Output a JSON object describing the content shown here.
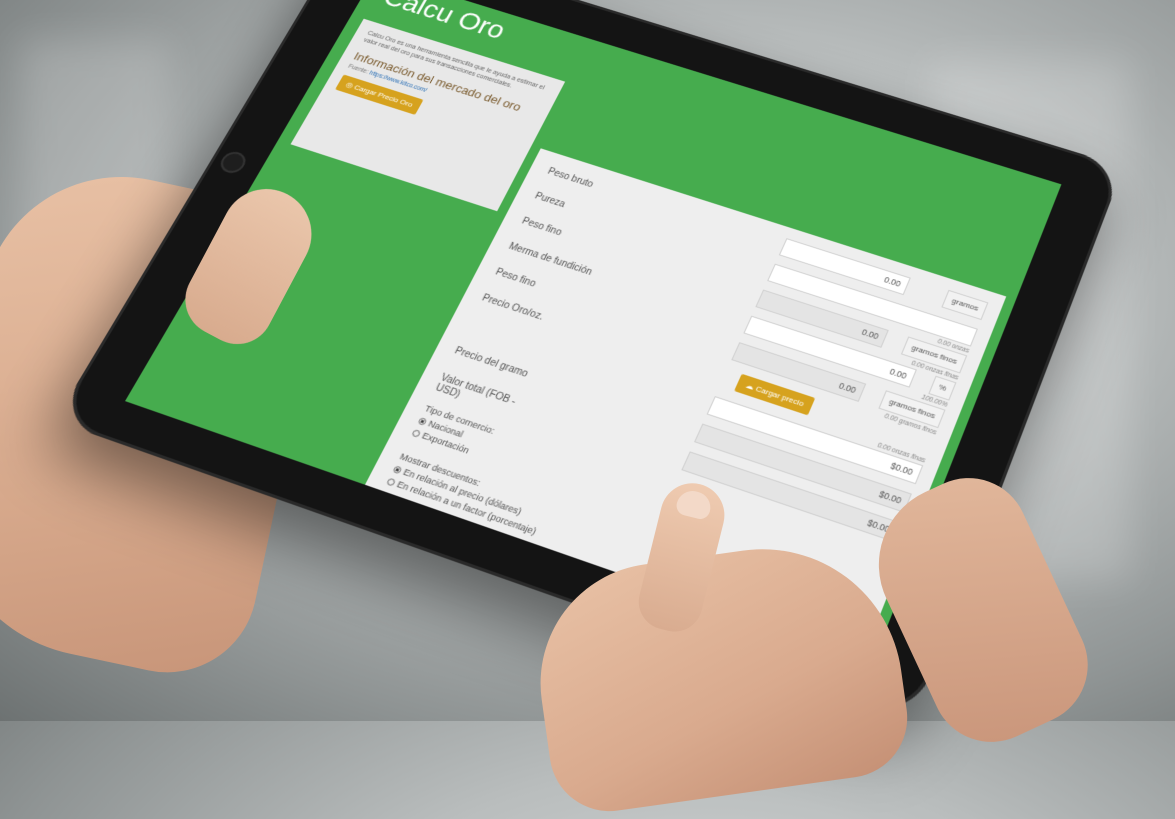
{
  "app": {
    "title": "Calcu Oro",
    "description": "Calcu Oro es una herramienta sencilla que le ayuda a estimar el valor real del oro para sus transacciones comerciales.",
    "market_heading": "Información del mercado del oro",
    "source_label": "Fuente:",
    "source_link": "https://www.kitco.com/",
    "load_gold_price_button": "Cargar Precio Oro"
  },
  "form": {
    "fields": [
      {
        "label": "Peso bruto",
        "value": "0.00",
        "unit": "gramos",
        "hint": "0.00 onzas"
      },
      {
        "label": "Pureza",
        "value": "",
        "unit": "",
        "hint": "100.00%"
      },
      {
        "label": "Peso fino",
        "value": "0.00",
        "unit": "gramos finos",
        "hint": "0.00 onzas finas"
      },
      {
        "label": "Merma de fundición",
        "value": "0.00",
        "unit": "%",
        "hint": "0.00 gramos finos"
      },
      {
        "label": "Peso fino",
        "value": "0.00",
        "unit": "gramos finos",
        "hint": "0.00 onzas finas"
      },
      {
        "label": "Precio Oro/oz.",
        "value": "$0.00",
        "unit": "",
        "hint": ""
      },
      {
        "label": "Precio del gramo",
        "value": "$0.00",
        "unit": "",
        "hint": ""
      },
      {
        "label": "Valor total (FOB - USD)",
        "value": "$0.00",
        "unit": "",
        "hint": ""
      }
    ],
    "hint_fine_oz_extra": "0.00 onzas finas",
    "load_price_button": "Cargar precio",
    "trade_type": {
      "label": "Tipo de comercio:",
      "options": [
        "Nacional",
        "Exportación"
      ],
      "selected": "Nacional"
    },
    "discounts": {
      "label": "Mostrar descuentos:",
      "options": [
        "En relación al precio (dólares)",
        "En relación a un factor (porcentaje)"
      ],
      "selected": "En relación al precio (dólares)"
    }
  },
  "colors": {
    "screen_green": "#46ac4e",
    "gold_button": "#d6a21e",
    "heading_brown": "#7a5b2e"
  }
}
